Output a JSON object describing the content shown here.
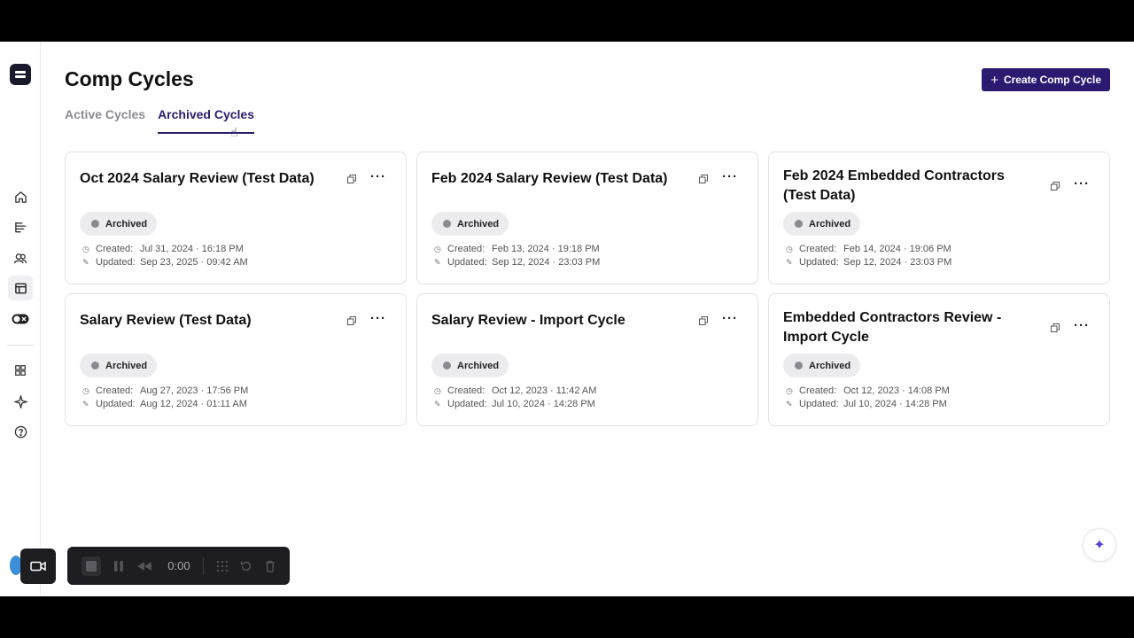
{
  "page": {
    "title": "Comp Cycles",
    "create_button": "Create Comp Cycle",
    "tabs": [
      {
        "label": "Active Cycles",
        "active": false
      },
      {
        "label": "Archived Cycles",
        "active": true
      }
    ]
  },
  "labels": {
    "created": "Created:",
    "updated": "Updated:"
  },
  "cards": [
    {
      "title": "Oct 2024 Salary Review (Test Data)",
      "status": "Archived",
      "created": "Jul 31, 2024 · 16:18 PM",
      "updated": "Sep 23, 2025 · 09:42 AM"
    },
    {
      "title": "Feb 2024 Salary Review (Test Data)",
      "status": "Archived",
      "created": "Feb 13, 2024 · 19:18 PM",
      "updated": "Sep 12, 2024 · 23:03 PM"
    },
    {
      "title": "Feb 2024 Embedded Contractors (Test Data)",
      "status": "Archived",
      "created": "Feb 14, 2024 · 19:06 PM",
      "updated": "Sep 12, 2024 · 23:03 PM"
    },
    {
      "title": "Salary Review (Test Data)",
      "status": "Archived",
      "created": "Aug 27, 2023 · 17:56 PM",
      "updated": "Aug 12, 2024 · 01:11 AM"
    },
    {
      "title": "Salary Review - Import Cycle",
      "status": "Archived",
      "created": "Oct 12, 2023 · 11:42 AM",
      "updated": "Jul 10, 2024 · 14:28 PM"
    },
    {
      "title": "Embedded Contractors Review - Import Cycle",
      "status": "Archived",
      "created": "Oct 12, 2023 · 14:08 PM",
      "updated": "Jul 10, 2024 · 14:28 PM"
    }
  ],
  "recorder": {
    "timer": "0:00"
  },
  "colors": {
    "accent": "#2b1a6f",
    "badge_bg": "#ececef",
    "badge_dot": "#8a8a92"
  }
}
